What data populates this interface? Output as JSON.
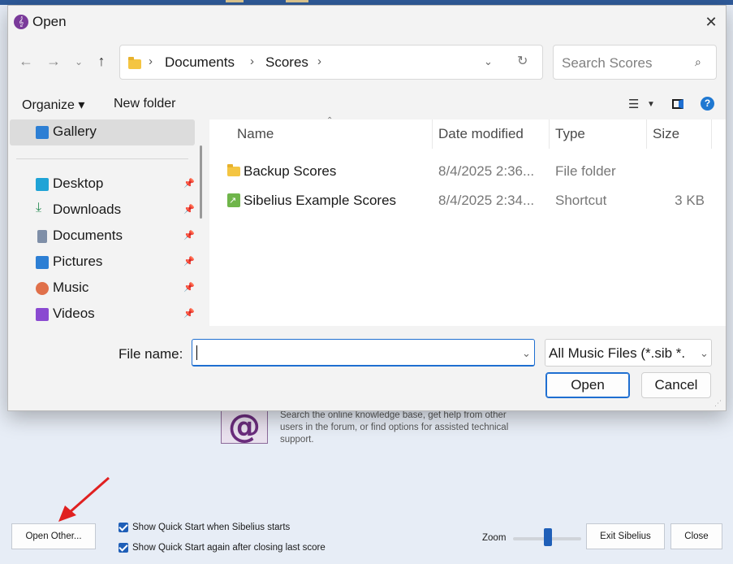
{
  "background": {
    "support_text": "Search the online knowledge base, get help from other users in the forum, or find options for assisted technical support.",
    "support_icon_glyph": "@",
    "open_other_label": "Open Other...",
    "checkbox1_label": "Show Quick Start when Sibelius starts",
    "checkbox2_label": "Show Quick Start again after closing last score",
    "zoom_label": "Zoom",
    "zoom_level": 0.5,
    "exit_label": "Exit Sibelius",
    "close_label": "Close"
  },
  "dialog": {
    "title": "Open",
    "title_icon": "sibelius-logo-icon",
    "close_glyph": "✕",
    "address": {
      "crumbs": [
        "Documents",
        "Scores"
      ],
      "sep": "›"
    },
    "search_placeholder": "Search Scores",
    "toolbar": {
      "organize": "Organize ▾",
      "new_folder": "New folder"
    },
    "sidebar": {
      "gallery": "Gallery",
      "items": [
        {
          "label": "Desktop",
          "icon": "desktop-icon",
          "color": "#1fa3d6"
        },
        {
          "label": "Downloads",
          "icon": "downloads-icon",
          "color": "#2f8f5a"
        },
        {
          "label": "Documents",
          "icon": "documents-icon",
          "color": "#7f8fa8"
        },
        {
          "label": "Pictures",
          "icon": "pictures-icon",
          "color": "#2d7fd4"
        },
        {
          "label": "Music",
          "icon": "music-icon",
          "color": "#e0704a"
        },
        {
          "label": "Videos",
          "icon": "videos-icon",
          "color": "#8a4ad1"
        }
      ]
    },
    "columns": [
      "Name",
      "Date modified",
      "Type",
      "Size"
    ],
    "files": [
      {
        "name": "Backup Scores",
        "date": "8/4/2025 2:36...",
        "type": "File folder",
        "size": "",
        "icon": "folder-icon"
      },
      {
        "name": "Sibelius Example Scores",
        "date": "8/4/2025 2:34...",
        "type": "Shortcut",
        "size": "3 KB",
        "icon": "shortcut-icon"
      }
    ],
    "file_name_label": "File name:",
    "file_name_value": "",
    "filter_value": "All Music Files (*.sib *.",
    "open_label": "Open",
    "cancel_label": "Cancel"
  }
}
